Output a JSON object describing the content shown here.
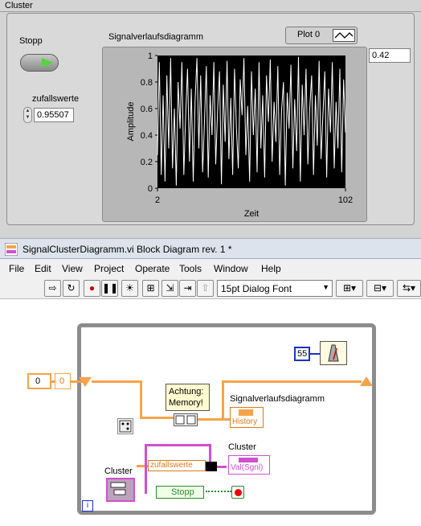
{
  "front_panel": {
    "cluster_label": "Cluster",
    "stopp_label": "Stopp",
    "zufallswerte_label": "zufallswerte",
    "zufallswerte_value": "0.95507",
    "chart_title": "Signalverlaufsdiagramm",
    "plot_legend": "Plot 0",
    "side_value": "0.42"
  },
  "chart_data": {
    "type": "line",
    "title": "Signalverlaufsdiagramm",
    "xlabel": "Zeit",
    "ylabel": "Amplitude",
    "xlim": [
      2,
      102
    ],
    "ylim": [
      0,
      1
    ],
    "x_ticks": [
      "2",
      "102"
    ],
    "y_ticks": [
      "0",
      "0.2",
      "0.4",
      "0.6",
      "0.8",
      "1"
    ],
    "series": [
      {
        "name": "Plot 0",
        "color": "#ffffff",
        "values": [
          0.25,
          0.95,
          0.1,
          0.7,
          0.05,
          0.85,
          0.3,
          0.98,
          0.15,
          0.6,
          0.02,
          0.8,
          0.45,
          0.95,
          0.1,
          0.55,
          0.9,
          0.2,
          0.75,
          0.05,
          0.65,
          0.98,
          0.3,
          0.85,
          0.12,
          0.5,
          0.92,
          0.08,
          0.7,
          0.4,
          0.95,
          0.18,
          0.6,
          0.88,
          0.03,
          0.78,
          0.35,
          0.96,
          0.22,
          0.68,
          0.1,
          0.9,
          0.45,
          0.15,
          0.82,
          0.55,
          0.98,
          0.25,
          0.62,
          0.05,
          0.88,
          0.4,
          0.75,
          0.12,
          0.95,
          0.3,
          0.7,
          0.08,
          0.85,
          0.5,
          0.97,
          0.2,
          0.65,
          0.35,
          0.92,
          0.1,
          0.58,
          0.8,
          0.02,
          0.72,
          0.45,
          0.93,
          0.15,
          0.67,
          0.28,
          0.99,
          0.05,
          0.78,
          0.4,
          0.9,
          0.18,
          0.6,
          0.85,
          0.1,
          0.7,
          0.32,
          0.96,
          0.22,
          0.55,
          0.88,
          0.08,
          0.75,
          0.42,
          0.95,
          0.15,
          0.65,
          0.3,
          0.9,
          0.12,
          0.82,
          0.42
        ]
      }
    ]
  },
  "block_diagram": {
    "title": "SignalClusterDiagramm.vi Block Diagram rev. 1 *",
    "menu": [
      "File",
      "Edit",
      "View",
      "Project",
      "Operate",
      "Tools",
      "Window",
      "Help"
    ],
    "font_select": "15pt Dialog Font",
    "wait_value": "55",
    "shift_init": "0",
    "shift_out": "0",
    "warning_label": "Achtung:\nMemory!",
    "diagram_label": "Signalverlaufsdiagramm",
    "history_label": "History",
    "cluster_label": "Cluster",
    "val_sgnl": "Val(Sgnl)",
    "zufallswerte": "zufallswerte",
    "cluster_control_label": "Cluster",
    "stopp": "Stopp",
    "loop_index": "i"
  }
}
